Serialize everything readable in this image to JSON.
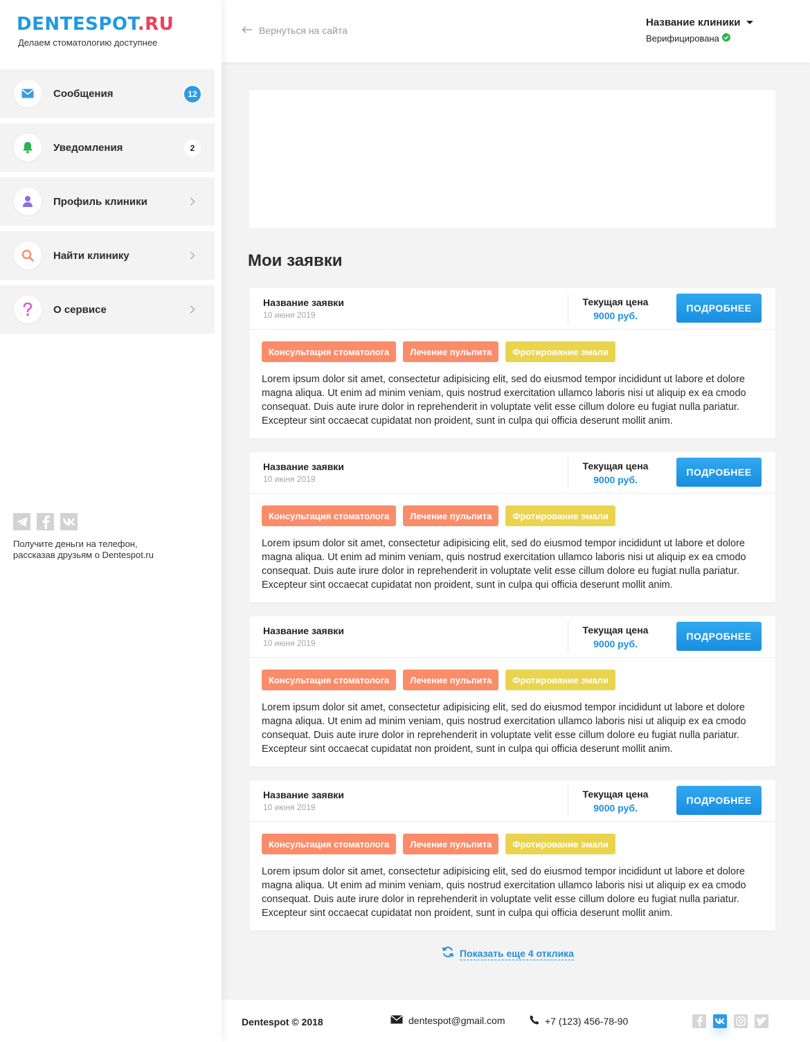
{
  "brand": {
    "logo_main": "DENTESPOT",
    "logo_suffix": ".RU",
    "tagline": "Делаем стоматологию доступнее"
  },
  "sidebar": {
    "items": [
      {
        "label": "Сообщения",
        "icon": "envelope-icon",
        "badge": "12"
      },
      {
        "label": "Уведомления",
        "icon": "bell-icon",
        "badge": "2"
      },
      {
        "label": "Профиль клиники",
        "icon": "user-icon"
      },
      {
        "label": "Найти клинику",
        "icon": "search-icon"
      },
      {
        "label": "О сервисе",
        "icon": "question-icon"
      }
    ],
    "share_text": "Получите деньги на телефон, рассказав друзьям о Dentespot.ru",
    "share_icons": [
      "telegram-icon",
      "facebook-icon",
      "vk-icon"
    ]
  },
  "header": {
    "back_link": "Вернуться на сайта",
    "clinic_name": "Название клиники",
    "clinic_status": "Верифицирована"
  },
  "main": {
    "title": "Мои заявки",
    "requests": [
      {
        "title": "Название заявки",
        "date": "10 июня 2019",
        "price_label": "Текущая цена",
        "price": "9000 руб.",
        "button": "ПОДРОБНЕЕ",
        "tags": [
          "Консультация стоматолога",
          "Лечение пульпита",
          "Фротирование эмали"
        ],
        "text": "Lorem ipsum dolor sit amet, consectetur adipisicing elit, sed do eiusmod tempor incididunt ut labore et dolore magna aliqua. Ut enim ad minim veniam, quis nostrud exercitation ullamco laboris nisi ut aliquip ex ea cmodo consequat. Duis aute irure dolor in reprehenderit in voluptate velit esse cillum dolore eu fugiat nulla pariatur. Excepteur sint occaecat cupidatat non proident, sunt in culpa qui officia deserunt mollit anim."
      },
      {
        "title": "Название заявки",
        "date": "10 июня 2019",
        "price_label": "Текущая цена",
        "price": "9000 руб.",
        "button": "ПОДРОБНЕЕ",
        "tags": [
          "Консультация стоматолога",
          "Лечение пульпита",
          "Фротирование эмали"
        ],
        "text": "Lorem ipsum dolor sit amet, consectetur adipisicing elit, sed do eiusmod tempor incididunt ut labore et dolore magna aliqua. Ut enim ad minim veniam, quis nostrud exercitation ullamco laboris nisi ut aliquip ex ea cmodo consequat. Duis aute irure dolor in reprehenderit in voluptate velit esse cillum dolore eu fugiat nulla pariatur. Excepteur sint occaecat cupidatat non proident, sunt in culpa qui officia deserunt mollit anim."
      },
      {
        "title": "Название заявки",
        "date": "10 июня 2019",
        "price_label": "Текущая цена",
        "price": "9000 руб.",
        "button": "ПОДРОБНЕЕ",
        "tags": [
          "Консультация стоматолога",
          "Лечение пульпита",
          "Фротирование эмали"
        ],
        "text": "Lorem ipsum dolor sit amet, consectetur adipisicing elit, sed do eiusmod tempor incididunt ut labore et dolore magna aliqua. Ut enim ad minim veniam, quis nostrud exercitation ullamco laboris nisi ut aliquip ex ea cmodo consequat. Duis aute irure dolor in reprehenderit in voluptate velit esse cillum dolore eu fugiat nulla pariatur. Excepteur sint occaecat cupidatat non proident, sunt in culpa qui officia deserunt mollit anim."
      },
      {
        "title": "Название заявки",
        "date": "10 июня 2019",
        "price_label": "Текущая цена",
        "price": "9000 руб.",
        "button": "ПОДРОБНЕЕ",
        "tags": [
          "Консультация стоматолога",
          "Лечение пульпита",
          "Фротирование эмали"
        ],
        "text": "Lorem ipsum dolor sit amet, consectetur adipisicing elit, sed do eiusmod tempor incididunt ut labore et dolore magna aliqua. Ut enim ad minim veniam, quis nostrud exercitation ullamco laboris nisi ut aliquip ex ea cmodo consequat. Duis aute irure dolor in reprehenderit in voluptate velit esse cillum dolore eu fugiat nulla pariatur. Excepteur sint occaecat cupidatat non proident, sunt in culpa qui officia deserunt mollit anim."
      }
    ],
    "show_more": "Показать еще 4 отклика"
  },
  "footer": {
    "copyright": "Dentespot © 2018",
    "email": "dentespot@gmail.com",
    "phone": "+7 (123) 456-78-90",
    "social_icons": [
      "facebook-icon",
      "vk-icon",
      "instagram-icon",
      "twitter-icon"
    ]
  },
  "colors": {
    "brand_blue": "#1e9ae3",
    "brand_red": "#f23b5a",
    "accent_blue": "#1f8fe0",
    "tag_orange": "#fb8c6a",
    "tag_yellow": "#ebd44d",
    "verified_green": "#2bb24c"
  }
}
